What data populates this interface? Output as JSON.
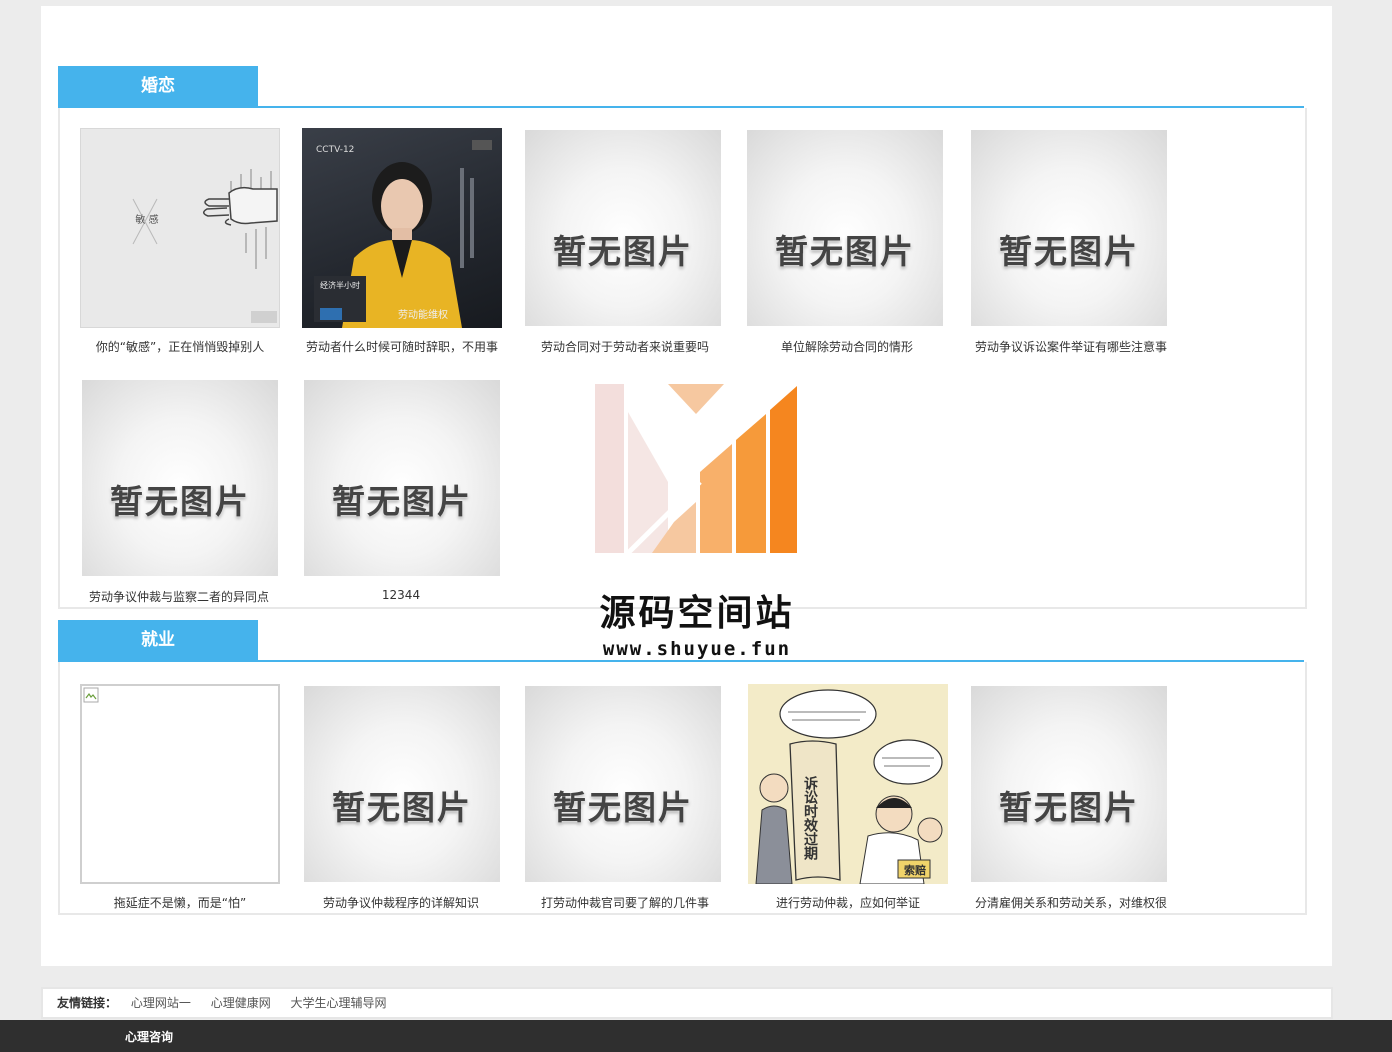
{
  "sections": [
    {
      "title": "婚恋",
      "items": [
        {
          "caption": "你的“敏感”，正在悄悄毁掉别人",
          "image": "sensitive"
        },
        {
          "caption": "劳动者什么时候可随时辞职，不用事",
          "image": "anchor"
        },
        {
          "caption": "劳动合同对于劳动者来说重要吗",
          "image": "placeholder"
        },
        {
          "caption": "单位解除劳动合同的情形",
          "image": "placeholder"
        },
        {
          "caption": "劳动争议诉讼案件举证有哪些注意事",
          "image": "placeholder"
        },
        {
          "caption": "劳动争议仲裁与监察二者的异同点",
          "image": "placeholder"
        },
        {
          "caption": "12344",
          "image": "placeholder"
        }
      ]
    },
    {
      "title": "就业",
      "items": [
        {
          "caption": "拖延症不是懒，而是“怕”",
          "image": "broken"
        },
        {
          "caption": "劳动争议仲裁程序的详解知识",
          "image": "placeholder"
        },
        {
          "caption": "打劳动仲裁官司要了解的几件事",
          "image": "placeholder"
        },
        {
          "caption": "进行劳动仲裁，应如何举证",
          "image": "comic"
        },
        {
          "caption": "分清雇佣关系和劳动关系，对维权很",
          "image": "placeholder"
        }
      ]
    }
  ],
  "placeholder_text": "暂无图片",
  "sensitive_text": "敏 感",
  "anchor": {
    "logo": "CCTV-12",
    "banner": "劳动能维权"
  },
  "comic": {
    "scroll": "诉讼时效过期",
    "badge": "索赔"
  },
  "footer": {
    "label": "友情链接：",
    "links": [
      "心理网站一",
      "心理健康网",
      "大学生心理辅导网"
    ],
    "bar": "心理咨询"
  },
  "watermark": {
    "title": "源码空间站",
    "url": "www.shuyue.fun"
  },
  "colors": {
    "accent": "#45b3ec",
    "footer_bar": "#2f2f2f",
    "logo_orange": "#f5861f"
  }
}
